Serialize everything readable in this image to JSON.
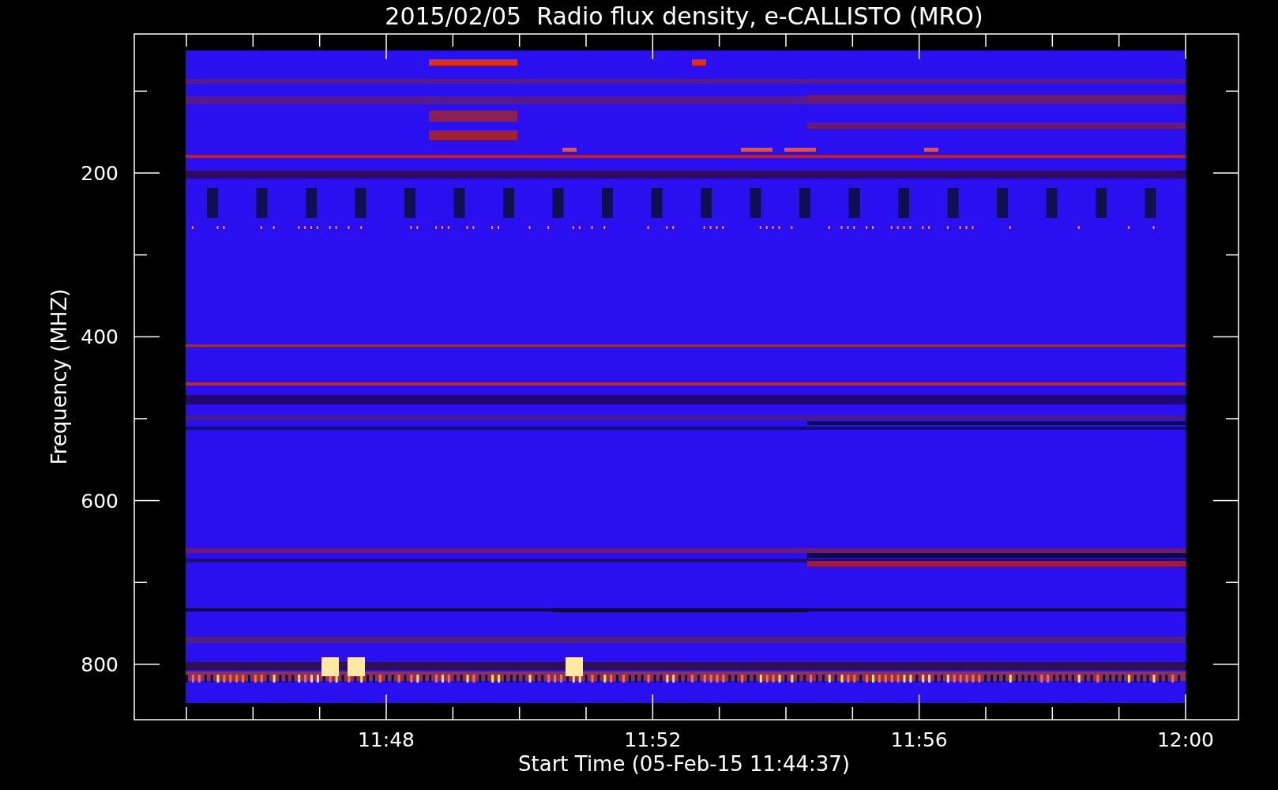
{
  "title": "2015/02/05  Radio flux density, e-CALLISTO (MRO)",
  "ylabel": "Frequency (MHZ)",
  "xlabel": "Start Time (05-Feb-15 11:44:37)",
  "yticks": [
    "200",
    "400",
    "600",
    "800"
  ],
  "xticks": [
    "11:48",
    "11:52",
    "11:56",
    "12:00"
  ]
}
